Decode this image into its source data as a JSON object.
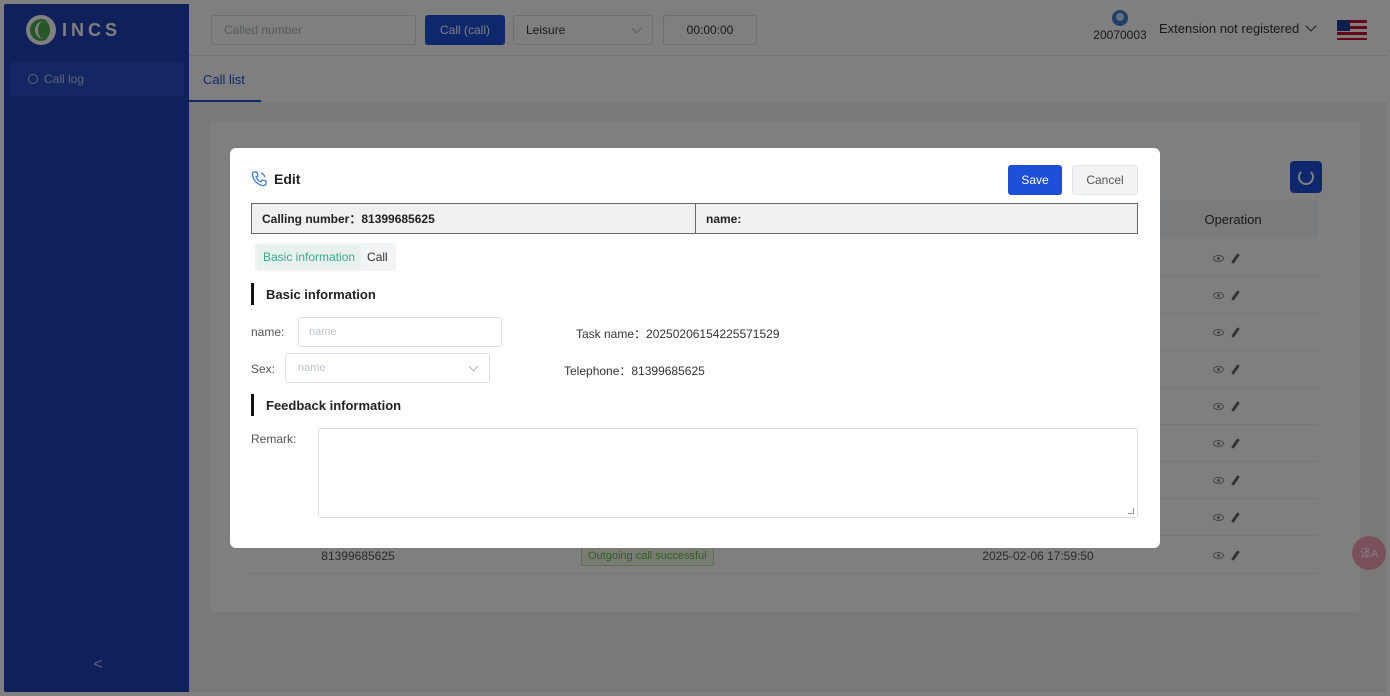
{
  "brand": {
    "name": "INCS"
  },
  "sidebar": {
    "items": [
      {
        "label": "Call log"
      }
    ],
    "collapse_glyph": "<"
  },
  "header": {
    "called_placeholder": "Called number",
    "call_button": "Call (call)",
    "status": "Leisure",
    "timer": "00:00:00",
    "extension_number": "20070003",
    "extension_status": "Extension not registered"
  },
  "tabs": [
    {
      "label": "Call list"
    }
  ],
  "table": {
    "operation_header": "Operation",
    "last_row": {
      "number": "81399685625",
      "status": "Outgoing call successful",
      "time": "2025-02-06 17:59:50"
    }
  },
  "floating": {
    "label": "译A"
  },
  "modal": {
    "title": "Edit",
    "save": "Save",
    "cancel": "Cancel",
    "calling_number": "Calling number：81399685625",
    "name_header": "name:",
    "subtabs": [
      "Basic information",
      "Call"
    ],
    "basic_section": "Basic information",
    "name_label": "name:",
    "name_placeholder": "name",
    "task_name": "Task name：20250206154225571529",
    "sex_label": "Sex:",
    "sex_placeholder": "name",
    "telephone": "Telephone：81399685625",
    "feedback_section": "Feedback information",
    "remark_label": "Remark:"
  },
  "colors": {
    "sidebar": "#1e40b5",
    "primary": "#1e4fd8",
    "success": "#67c23a"
  }
}
